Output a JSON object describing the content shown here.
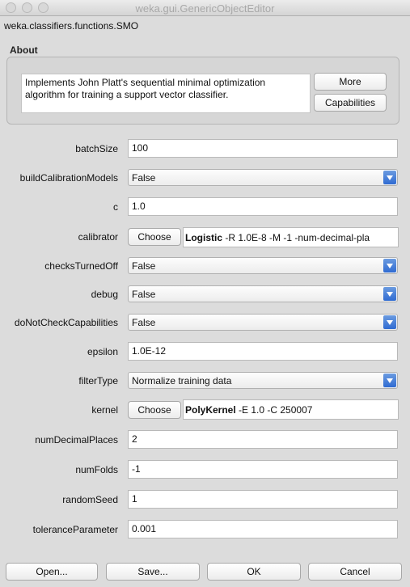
{
  "window": {
    "title": "weka.gui.GenericObjectEditor",
    "class_name": "weka.classifiers.functions.SMO"
  },
  "about": {
    "heading": "About",
    "description_line1": "Implements John Platt's sequential minimal optimization",
    "description_line2": "algorithm for training a support vector classifier.",
    "more_label": "More",
    "capabilities_label": "Capabilities"
  },
  "params": {
    "batchSize": {
      "label": "batchSize",
      "value": "100"
    },
    "buildCalibrationModels": {
      "label": "buildCalibrationModels",
      "value": "False"
    },
    "c": {
      "label": "c",
      "value": "1.0"
    },
    "calibrator": {
      "label": "calibrator",
      "choose": "Choose",
      "name": "Logistic",
      "args": " -R 1.0E-8 -M -1 -num-decimal-pla"
    },
    "checksTurnedOff": {
      "label": "checksTurnedOff",
      "value": "False"
    },
    "debug": {
      "label": "debug",
      "value": "False"
    },
    "doNotCheckCapabilities": {
      "label": "doNotCheckCapabilities",
      "value": "False"
    },
    "epsilon": {
      "label": "epsilon",
      "value": "1.0E-12"
    },
    "filterType": {
      "label": "filterType",
      "value": "Normalize training data"
    },
    "kernel": {
      "label": "kernel",
      "choose": "Choose",
      "name": "PolyKernel",
      "args": " -E 1.0 -C 250007"
    },
    "numDecimalPlaces": {
      "label": "numDecimalPlaces",
      "value": "2"
    },
    "numFolds": {
      "label": "numFolds",
      "value": "-1"
    },
    "randomSeed": {
      "label": "randomSeed",
      "value": "1"
    },
    "toleranceParameter": {
      "label": "toleranceParameter",
      "value": "0.001"
    }
  },
  "buttons": {
    "open": "Open...",
    "save": "Save...",
    "ok": "OK",
    "cancel": "Cancel"
  },
  "colors": {
    "dropdown_accent": "#2f6bd2",
    "window_bg": "#dcdcdc"
  }
}
